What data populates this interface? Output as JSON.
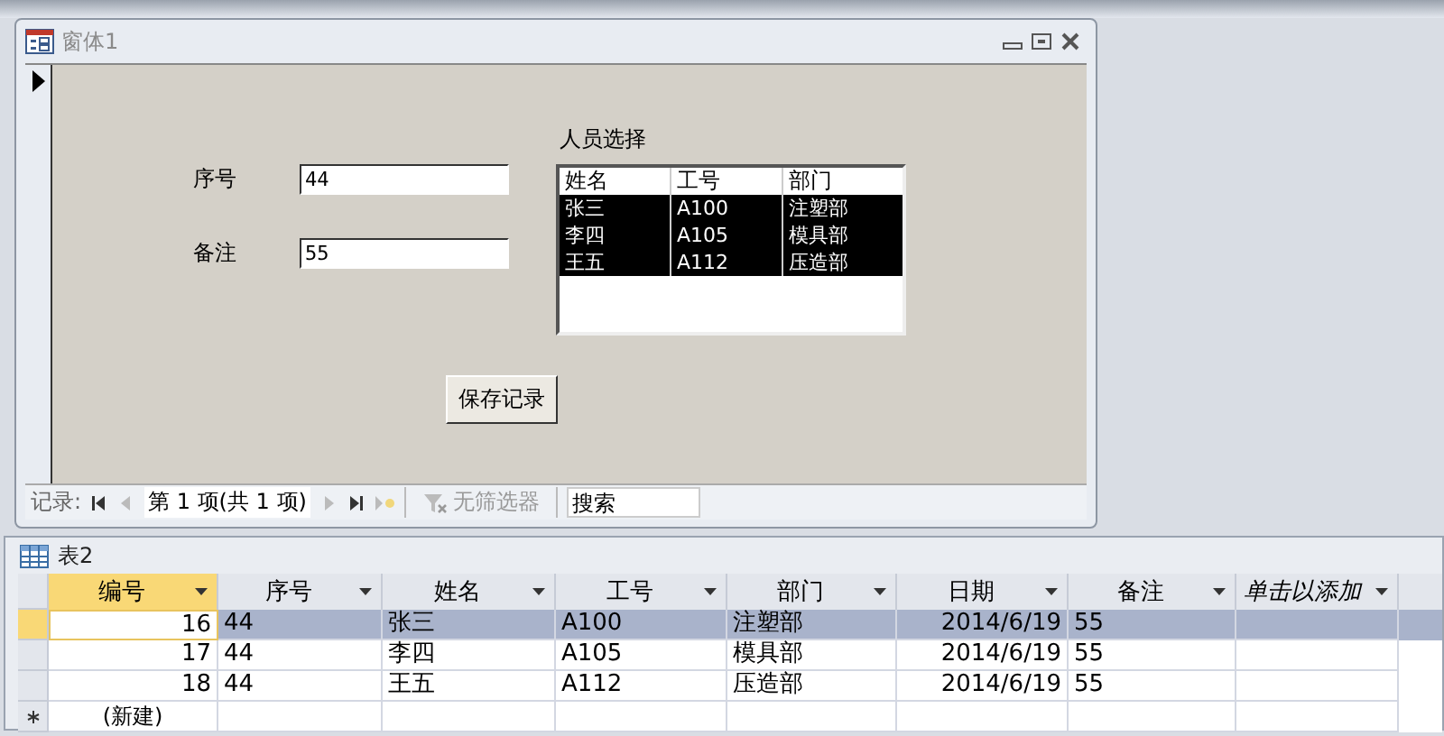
{
  "form_window": {
    "title": "窗体1",
    "fields": [
      {
        "label": "序号",
        "value": "44"
      },
      {
        "label": "备注",
        "value": "55"
      }
    ],
    "listbox": {
      "label": "人员选择",
      "columns": [
        "姓名",
        "工号",
        "部门"
      ],
      "rows": [
        {
          "cells": [
            "张三",
            "A100",
            "注塑部"
          ],
          "selected": true
        },
        {
          "cells": [
            "李四",
            "A105",
            "模具部"
          ],
          "selected": true
        },
        {
          "cells": [
            "王五",
            "A112",
            "压造部"
          ],
          "selected": true
        }
      ]
    },
    "save_button": "保存记录",
    "navigation": {
      "label": "记录:",
      "position": "第 1 项(共 1 项)",
      "filter": "无筛选器",
      "search": {
        "placeholder": "搜索"
      }
    }
  },
  "table_window": {
    "title": "表2",
    "columns": [
      {
        "label": "编号",
        "selected": true,
        "kind": "field"
      },
      {
        "label": "序号",
        "selected": false,
        "kind": "field"
      },
      {
        "label": "姓名",
        "selected": false,
        "kind": "field"
      },
      {
        "label": "工号",
        "selected": false,
        "kind": "field"
      },
      {
        "label": "部门",
        "selected": false,
        "kind": "field"
      },
      {
        "label": "日期",
        "selected": false,
        "kind": "field"
      },
      {
        "label": "备注",
        "selected": false,
        "kind": "field"
      },
      {
        "label": "单击以添加",
        "selected": false,
        "kind": "add"
      }
    ],
    "rows": [
      {
        "kind": "record",
        "selected": true,
        "cells": [
          "16",
          "44",
          "张三",
          "A100",
          "注塑部",
          "2014/6/19",
          "55",
          ""
        ]
      },
      {
        "kind": "record",
        "selected": false,
        "cells": [
          "17",
          "44",
          "李四",
          "A105",
          "模具部",
          "2014/6/19",
          "55",
          ""
        ]
      },
      {
        "kind": "record",
        "selected": false,
        "cells": [
          "18",
          "44",
          "王五",
          "A112",
          "压造部",
          "2014/6/19",
          "55",
          ""
        ]
      },
      {
        "kind": "new",
        "selected": false,
        "cells": [
          "(新建)"
        ]
      }
    ]
  }
}
